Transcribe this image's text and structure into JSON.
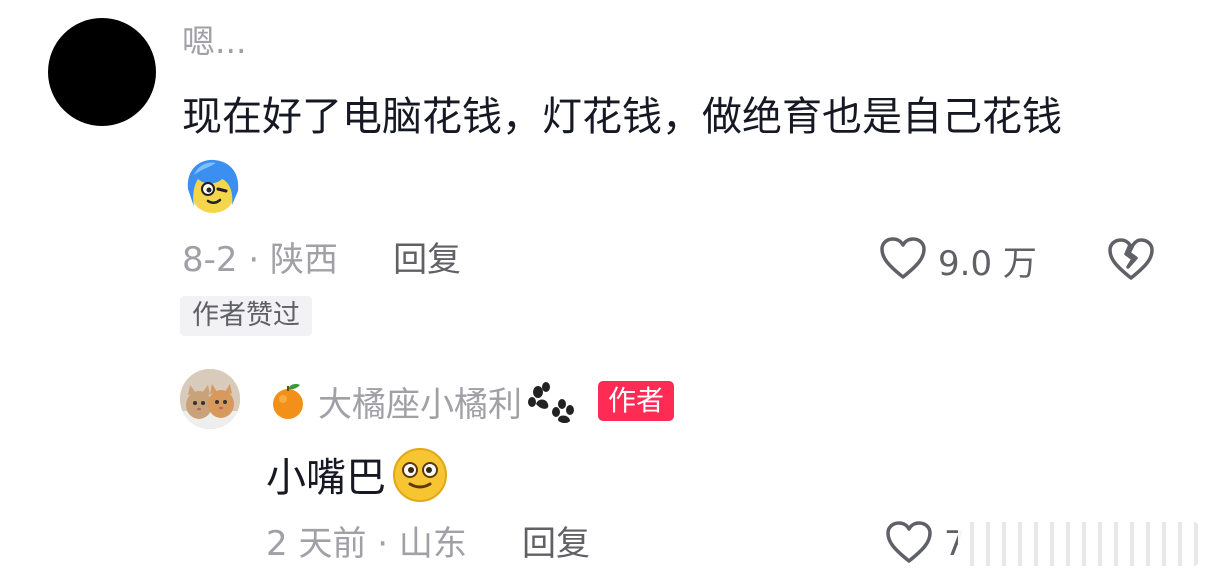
{
  "comment": {
    "username": "嗯...",
    "text": "现在好了电脑花钱，灯花钱，做绝育也是自己花钱",
    "sticker": "blue-hair-cartoon-sticker",
    "date_location": "8-2 · 陕西",
    "reply_label": "回复",
    "like_count": "9.0 万",
    "author_liked": "作者赞过"
  },
  "reply": {
    "username": "大橘座小橘利",
    "badge": "作者",
    "text": "小嘴巴",
    "date_location": "2 天前 · 山东",
    "reply_label": "回复",
    "like_count": "7"
  },
  "colors": {
    "text_primary": "#161823",
    "text_secondary": "#a0a0a6",
    "author_badge": "#fe2c55",
    "badge_bg": "#f2f2f4"
  }
}
